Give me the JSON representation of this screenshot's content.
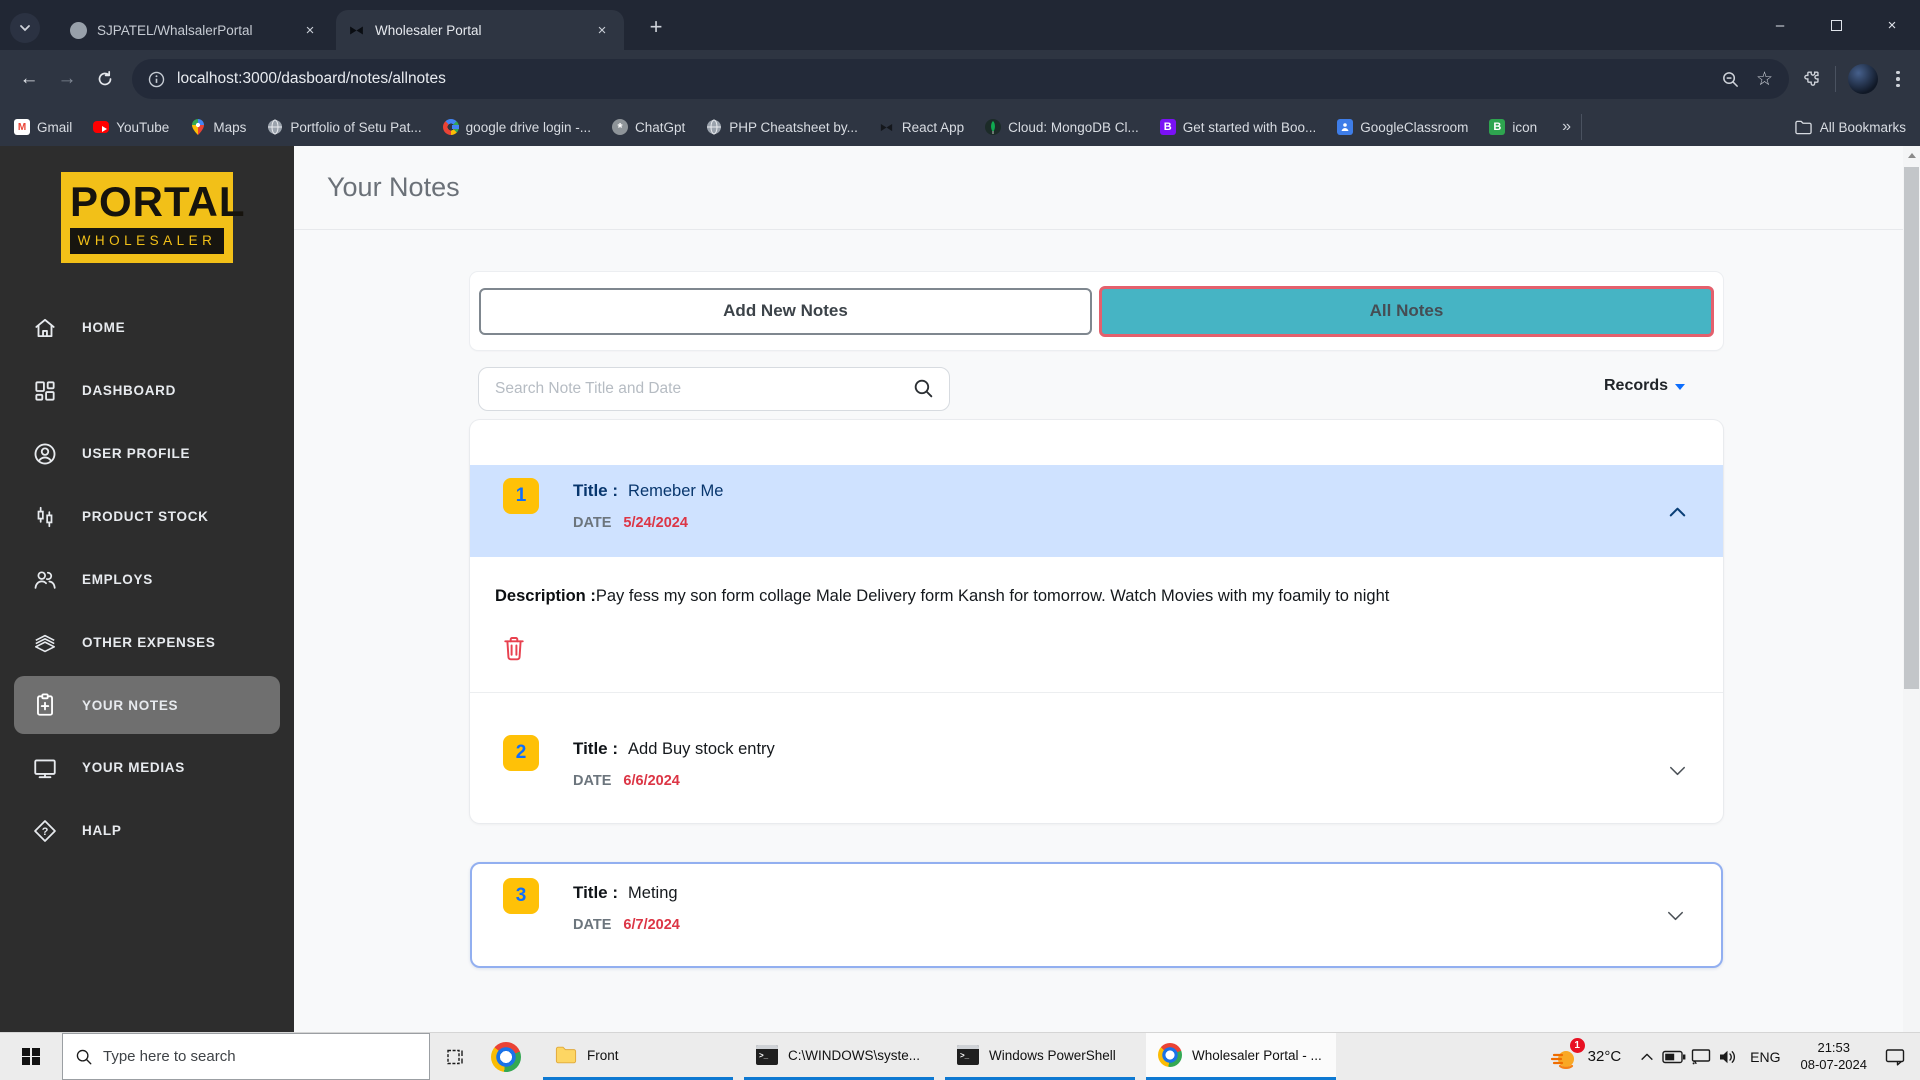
{
  "browser": {
    "tabs": [
      {
        "title": "SJPATEL/WhalsalerPortal"
      },
      {
        "title": "Wholesaler Portal"
      }
    ],
    "url": "localhost:3000/dasboard/notes/allnotes",
    "bookmarks": [
      {
        "label": "Gmail"
      },
      {
        "label": "YouTube"
      },
      {
        "label": "Maps"
      },
      {
        "label": "Portfolio of Setu Pat..."
      },
      {
        "label": "google drive login -..."
      },
      {
        "label": "ChatGpt"
      },
      {
        "label": "PHP Cheatsheet by..."
      },
      {
        "label": "React App"
      },
      {
        "label": "Cloud: MongoDB Cl..."
      },
      {
        "label": "Get started with Boo..."
      },
      {
        "label": "GoogleClassroom"
      },
      {
        "label": "icon"
      }
    ],
    "all_bookmarks": "All Bookmarks"
  },
  "glyphs": {
    "close": "×",
    "minimize": "–",
    "new_tab": "+",
    "back": "←",
    "forward": "→",
    "more_bookmarks": "»",
    "star": "☆",
    "gmail_letter": "M",
    "chatgpt_mark": "*",
    "bootstrap_letter": "B"
  },
  "sidebar": {
    "logo_top": "PORTAL",
    "logo_bottom": "WHOLESALER",
    "items": [
      {
        "label": "HOME"
      },
      {
        "label": "DASHBOARD"
      },
      {
        "label": "USER PROFILE"
      },
      {
        "label": "PRODUCT STOCK"
      },
      {
        "label": "EMPLOYS"
      },
      {
        "label": "OTHER EXPENSES"
      },
      {
        "label": "YOUR NOTES"
      },
      {
        "label": "YOUR MEDIAS"
      },
      {
        "label": "HALP"
      }
    ]
  },
  "main": {
    "page_title": "Your Notes",
    "tabs": {
      "add_new": "Add New Notes",
      "all_notes": "All Notes"
    },
    "search_placeholder": "Search Note Title and Date",
    "records": "Records",
    "notes": [
      {
        "index": "1",
        "title_label": "Title :",
        "title": "Remeber Me",
        "date_label": "DATE",
        "date": "5/24/2024",
        "description_label": "Description :",
        "description": "Pay fess my son form collage Male Delivery form Kansh for tomorrow. Watch Movies with my foamily to night"
      },
      {
        "index": "2",
        "title_label": "Title :",
        "title": "Add Buy stock entry",
        "date_label": "DATE",
        "date": "6/6/2024"
      },
      {
        "index": "3",
        "title_label": "Title :",
        "title": "Meting",
        "date_label": "DATE",
        "date": "6/7/2024"
      }
    ]
  },
  "taskbar": {
    "search_placeholder": "Type here to search",
    "apps": [
      {
        "label": "Front"
      },
      {
        "label": "C:\\WINDOWS\\syste..."
      },
      {
        "label": "Windows PowerShell"
      },
      {
        "label": "Wholesaler Portal - ..."
      }
    ],
    "tray": {
      "weather_badge": "1",
      "temperature": "32°C",
      "language": "ENG",
      "time": "21:53",
      "date": "08-07-2024"
    }
  },
  "colors": {
    "accent_teal": "#46b4c4",
    "all_notes_border": "#e4606d",
    "badge_yellow": "#ffc107",
    "badge_number_blue": "#0d6efd",
    "date_red": "#dc3545",
    "active_note_bg": "#cfe2ff",
    "sidebar_bg": "#2d2d2d",
    "logo_yellow": "#f2c018",
    "taskbar_underline_blue": "#0e79d2"
  }
}
